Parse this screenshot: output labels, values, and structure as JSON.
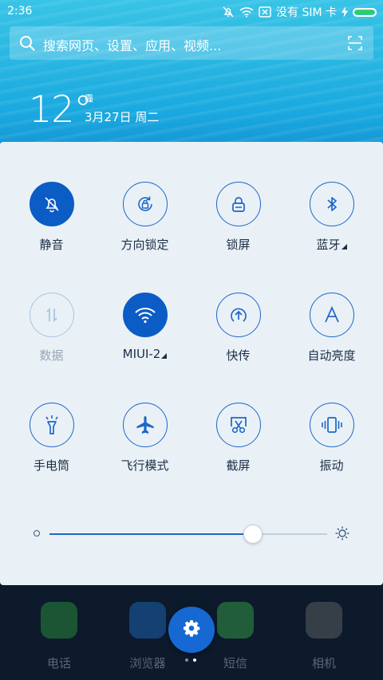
{
  "status_bar": {
    "time": "2:36",
    "carrier": "没有 SIM 卡",
    "battery_color": "#33d04a"
  },
  "search": {
    "placeholder": "搜索网页、设置、应用、视频..."
  },
  "weather": {
    "temperature": "12°",
    "condition": "霾",
    "date": "3月27日 周二"
  },
  "quick_settings": {
    "tiles": [
      {
        "label": "静音",
        "icon": "bell-off-icon",
        "state": "active"
      },
      {
        "label": "方向锁定",
        "icon": "rotation-lock-icon",
        "state": "inactive"
      },
      {
        "label": "锁屏",
        "icon": "lock-icon",
        "state": "inactive"
      },
      {
        "label": "蓝牙",
        "icon": "bluetooth-icon",
        "state": "inactive",
        "has_menu": true
      },
      {
        "label": "数据",
        "icon": "mobile-data-icon",
        "state": "disabled"
      },
      {
        "label": "MIUI-2",
        "icon": "wifi-icon",
        "state": "active",
        "has_menu": true
      },
      {
        "label": "快传",
        "icon": "quick-transfer-icon",
        "state": "inactive"
      },
      {
        "label": "自动亮度",
        "icon": "auto-brightness-icon",
        "state": "inactive"
      },
      {
        "label": "手电筒",
        "icon": "flashlight-icon",
        "state": "inactive"
      },
      {
        "label": "飞行模式",
        "icon": "airplane-icon",
        "state": "inactive"
      },
      {
        "label": "截屏",
        "icon": "screenshot-icon",
        "state": "inactive"
      },
      {
        "label": "振动",
        "icon": "vibrate-icon",
        "state": "inactive"
      }
    ],
    "brightness_level": 0.73,
    "accent_color": "#1e66c8"
  },
  "dock": {
    "apps": [
      {
        "label": "电话",
        "icon": "phone-icon",
        "color": "#2f9e3f"
      },
      {
        "label": "浏览器",
        "icon": "browser-icon",
        "color": "#1f6fc7"
      },
      {
        "label": "短信",
        "icon": "messages-icon",
        "color": "#3fb04a"
      },
      {
        "label": "相机",
        "icon": "camera-icon",
        "color": "#6a6a6a"
      }
    ],
    "settings_icon": "gear-icon"
  }
}
